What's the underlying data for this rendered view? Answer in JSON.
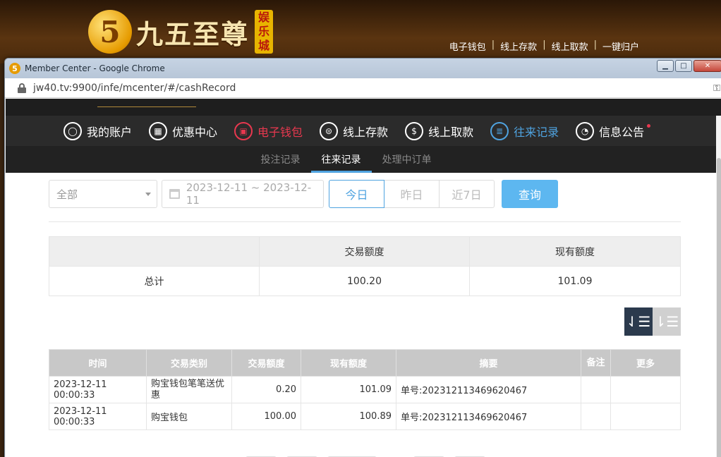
{
  "site": {
    "logo_digit": "5",
    "logo_name": "九五至尊",
    "logo_badge": [
      "娱",
      "乐",
      "城"
    ],
    "nav": [
      "电子钱包",
      "线上存款",
      "线上取款",
      "一键归户"
    ],
    "nav_sep": "|"
  },
  "window": {
    "title": "Member Center - Google Chrome",
    "url": "jw40.tv:9900/infe/mcenter/#/cashRecord",
    "controls": {
      "minimize": "▁",
      "maximize": "□",
      "close": "✕"
    }
  },
  "main_nav": [
    {
      "label": "我的账户",
      "icon": "user-icon",
      "glyph": "◯"
    },
    {
      "label": "优惠中心",
      "icon": "gift-icon",
      "glyph": "▦"
    },
    {
      "label": "电子钱包",
      "icon": "wallet-icon",
      "glyph": "▣"
    },
    {
      "label": "线上存款",
      "icon": "deposit-icon",
      "glyph": "⊜"
    },
    {
      "label": "线上取款",
      "icon": "withdraw-icon",
      "glyph": "$"
    },
    {
      "label": "往来记录",
      "icon": "record-icon",
      "glyph": "≣"
    },
    {
      "label": "信息公告",
      "icon": "bell-icon",
      "glyph": "◔"
    }
  ],
  "sub_nav": [
    "投注记录",
    "往来记录",
    "处理中订单"
  ],
  "filters": {
    "type_select": "全部",
    "date_range": "2023-12-11 ~ 2023-12-11",
    "quick_ranges": [
      "今日",
      "昨日",
      "近7日"
    ],
    "query_button": "查询"
  },
  "summary": {
    "headers": [
      "",
      "交易额度",
      "现有额度"
    ],
    "row": [
      "总计",
      "100.20",
      "101.09"
    ]
  },
  "sort": {
    "desc_glyph": "⇃☰",
    "asc_glyph": "⇂☰"
  },
  "records": {
    "headers": [
      "时间",
      "交易类别",
      "交易额度",
      "现有额度",
      "摘要",
      "备注",
      "更多"
    ],
    "rows": [
      [
        "2023-12-11 00:00:33",
        "购宝钱包笔笔送优惠",
        "0.20",
        "101.09",
        "单号:202312113469620467",
        "",
        ""
      ],
      [
        "2023-12-11 00:00:33",
        "购宝钱包",
        "100.00",
        "100.89",
        "单号:202312113469620467",
        "",
        ""
      ]
    ]
  }
}
